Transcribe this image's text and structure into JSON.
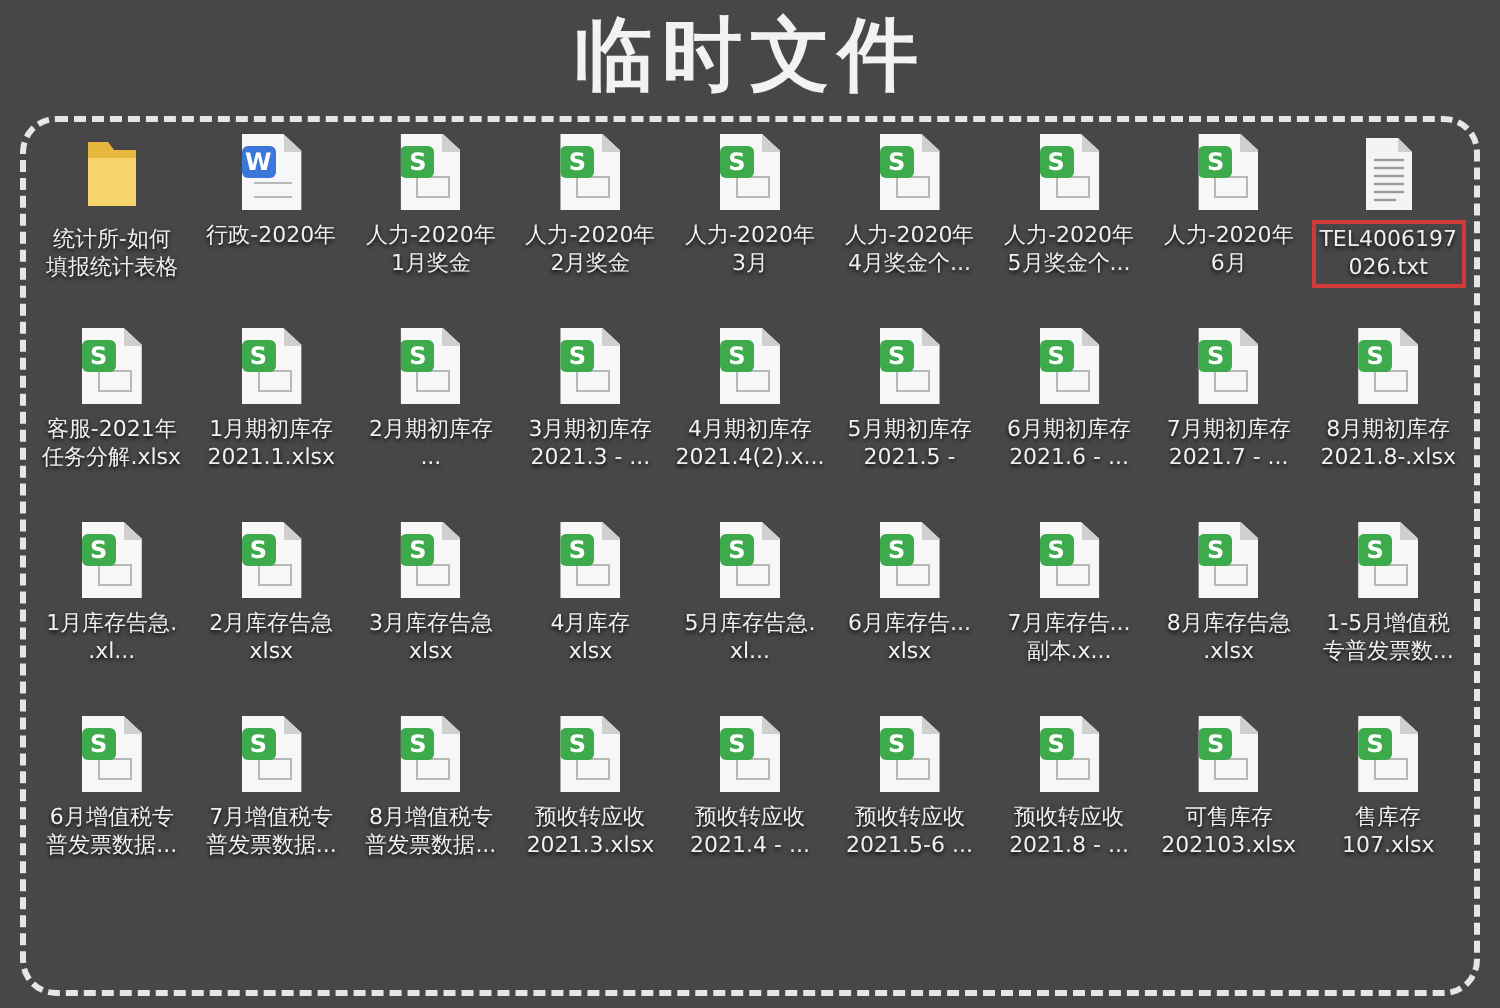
{
  "title": "临时文件",
  "files": [
    {
      "kind": "folder",
      "lines": [
        "统计所-如何",
        "填报统计表格"
      ],
      "highlighted": false
    },
    {
      "kind": "word",
      "badge": "W",
      "lines": [
        "行政-2020年"
      ],
      "highlighted": false
    },
    {
      "kind": "sheet",
      "badge": "S",
      "lines": [
        "人力-2020年",
        "1月奖金"
      ],
      "highlighted": false
    },
    {
      "kind": "sheet",
      "badge": "S",
      "lines": [
        "人力-2020年",
        "2月奖金"
      ],
      "highlighted": false
    },
    {
      "kind": "sheet",
      "badge": "S",
      "lines": [
        "人力-2020年",
        "3月"
      ],
      "highlighted": false
    },
    {
      "kind": "sheet",
      "badge": "S",
      "lines": [
        "人力-2020年",
        "4月奖金个..."
      ],
      "highlighted": false
    },
    {
      "kind": "sheet",
      "badge": "S",
      "lines": [
        "人力-2020年",
        "5月奖金个..."
      ],
      "highlighted": false
    },
    {
      "kind": "sheet",
      "badge": "S",
      "lines": [
        "人力-2020年",
        "6月"
      ],
      "highlighted": false
    },
    {
      "kind": "text",
      "lines": [
        "TEL4006197",
        "026.txt"
      ],
      "highlighted": true
    },
    {
      "kind": "sheet",
      "badge": "S",
      "lines": [
        "客服-2021年",
        "任务分解.xlsx"
      ],
      "highlighted": false
    },
    {
      "kind": "sheet",
      "badge": "S",
      "lines": [
        "1月期初库存",
        "2021.1.xlsx"
      ],
      "highlighted": false
    },
    {
      "kind": "sheet",
      "badge": "S",
      "lines": [
        "2月期初库存",
        "..."
      ],
      "highlighted": false
    },
    {
      "kind": "sheet",
      "badge": "S",
      "lines": [
        "3月期初库存",
        "2021.3 - ..."
      ],
      "highlighted": false
    },
    {
      "kind": "sheet",
      "badge": "S",
      "lines": [
        "4月期初库存",
        "2021.4(2).x..."
      ],
      "highlighted": false
    },
    {
      "kind": "sheet",
      "badge": "S",
      "lines": [
        "5月期初库存",
        "2021.5 -"
      ],
      "highlighted": false
    },
    {
      "kind": "sheet",
      "badge": "S",
      "lines": [
        "6月期初库存",
        "2021.6 - ..."
      ],
      "highlighted": false
    },
    {
      "kind": "sheet",
      "badge": "S",
      "lines": [
        "7月期初库存",
        "2021.7 - ..."
      ],
      "highlighted": false
    },
    {
      "kind": "sheet",
      "badge": "S",
      "lines": [
        "8月期初库存",
        "2021.8-.xlsx"
      ],
      "highlighted": false
    },
    {
      "kind": "sheet",
      "badge": "S",
      "lines": [
        "1月库存告急.",
        ".xl..."
      ],
      "highlighted": false
    },
    {
      "kind": "sheet",
      "badge": "S",
      "lines": [
        "2月库存告急",
        "xlsx"
      ],
      "highlighted": false
    },
    {
      "kind": "sheet",
      "badge": "S",
      "lines": [
        "3月库存告急",
        "xlsx"
      ],
      "highlighted": false
    },
    {
      "kind": "sheet",
      "badge": "S",
      "lines": [
        "4月库存",
        "xlsx"
      ],
      "highlighted": false
    },
    {
      "kind": "sheet",
      "badge": "S",
      "lines": [
        "5月库存告急.",
        "xl..."
      ],
      "highlighted": false
    },
    {
      "kind": "sheet",
      "badge": "S",
      "lines": [
        "6月库存告...",
        "xlsx"
      ],
      "highlighted": false
    },
    {
      "kind": "sheet",
      "badge": "S",
      "lines": [
        "7月库存告...",
        "副本.x..."
      ],
      "highlighted": false
    },
    {
      "kind": "sheet",
      "badge": "S",
      "lines": [
        "8月库存告急",
        ".xlsx"
      ],
      "highlighted": false
    },
    {
      "kind": "sheet",
      "badge": "S",
      "lines": [
        "1-5月增值税",
        "专普发票数..."
      ],
      "highlighted": false
    },
    {
      "kind": "sheet",
      "badge": "S",
      "lines": [
        "6月增值税专",
        "普发票数据..."
      ],
      "highlighted": false
    },
    {
      "kind": "sheet",
      "badge": "S",
      "lines": [
        "7月增值税专",
        "普发票数据..."
      ],
      "highlighted": false
    },
    {
      "kind": "sheet",
      "badge": "S",
      "lines": [
        "8月增值税专",
        "普发票数据..."
      ],
      "highlighted": false
    },
    {
      "kind": "sheet",
      "badge": "S",
      "lines": [
        "预收转应收",
        "2021.3.xlsx"
      ],
      "highlighted": false
    },
    {
      "kind": "sheet",
      "badge": "S",
      "lines": [
        "预收转应收",
        "2021.4 - ..."
      ],
      "highlighted": false
    },
    {
      "kind": "sheet",
      "badge": "S",
      "lines": [
        "预收转应收",
        "2021.5-6 ..."
      ],
      "highlighted": false
    },
    {
      "kind": "sheet",
      "badge": "S",
      "lines": [
        "预收转应收",
        "2021.8 - ..."
      ],
      "highlighted": false
    },
    {
      "kind": "sheet",
      "badge": "S",
      "lines": [
        "可售库存",
        "202103.xlsx"
      ],
      "highlighted": false
    },
    {
      "kind": "sheet",
      "badge": "S",
      "lines": [
        "售库存",
        "107.xlsx"
      ],
      "highlighted": false
    }
  ]
}
